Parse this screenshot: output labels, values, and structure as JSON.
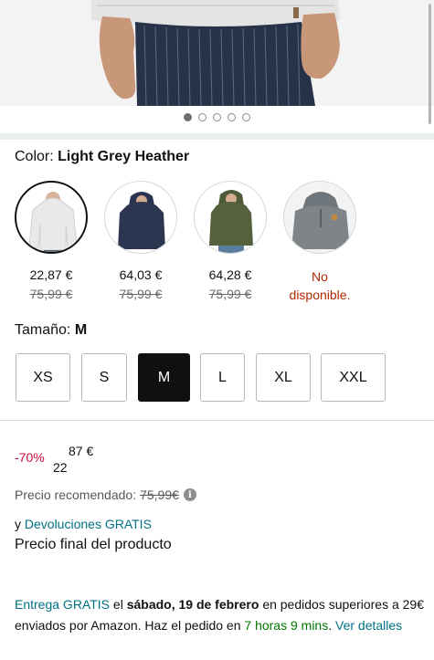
{
  "carousel": {
    "slides": 5,
    "active_index": 0
  },
  "color": {
    "label": "Color:",
    "selected_name": "Light Grey Heather",
    "options": [
      {
        "price": "22,87 €",
        "old_price": "75,99 €",
        "available": true,
        "selected": true,
        "hex": "#e6e6e6"
      },
      {
        "price": "64,03 €",
        "old_price": "75,99 €",
        "available": true,
        "selected": false,
        "hex": "#2d3650"
      },
      {
        "price": "64,28 €",
        "old_price": "75,99 €",
        "available": true,
        "selected": false,
        "hex": "#55613d"
      },
      {
        "unavailable_line1": "No",
        "unavailable_line2": "disponible.",
        "available": false,
        "selected": false,
        "hex": "#7e8488"
      }
    ]
  },
  "size": {
    "label": "Tamaño:",
    "selected": "M",
    "options": [
      "XS",
      "S",
      "M",
      "L",
      "XL",
      "XXL"
    ]
  },
  "price": {
    "discount": "-70%",
    "whole": "22",
    "fraction": "87 €",
    "rrp_label": "Precio recomendado:",
    "rrp_value": "75,99€",
    "returns_prefix": "y",
    "returns_link": "Devoluciones GRATIS",
    "final_label": "Precio final del producto"
  },
  "delivery": {
    "free_link": "Entrega GRATIS",
    "text1": "el",
    "date": "sábado, 19 de febrero",
    "text2": "en pedidos superiores a 29€ enviados por Amazon. Haz el pedido en",
    "countdown": "7 horas 9 mins",
    "details_link": "Ver detalles"
  },
  "colors": {
    "link": "#007185",
    "discount": "#cc0c39",
    "unavailable": "#b12704",
    "countdown": "#007600",
    "selected_size_bg": "#0f1111"
  }
}
